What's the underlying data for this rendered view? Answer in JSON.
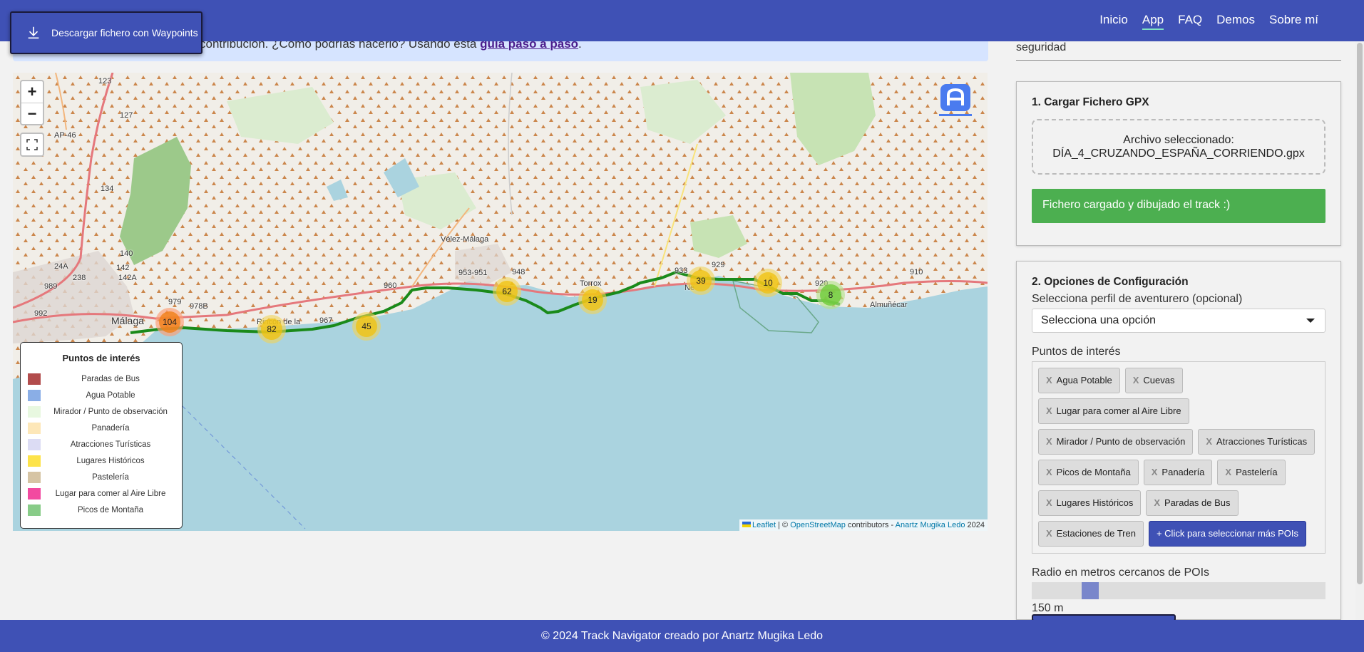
{
  "nav": {
    "links": [
      "Inicio",
      "App",
      "FAQ",
      "Demos",
      "Sobre mí"
    ],
    "active": "App"
  },
  "download_button": {
    "label": "Descargar fichero con Waypoints"
  },
  "banner": {
    "text": "contribución. ¿Cómo podrías hacerlo? Usando esta ",
    "link": "guía paso a paso",
    "end": "."
  },
  "map": {
    "zoom_in": "+",
    "zoom_out": "−",
    "places": {
      "malaga": "Málaga",
      "velez": "Vélez-Málaga",
      "torrox": "Torrox",
      "almunecar": "Almuñécar",
      "rincon": "Rincón de la",
      "nerja": "Ne"
    },
    "clusters": [
      "104",
      "82",
      "45",
      "62",
      "19",
      "39",
      "10",
      "8"
    ],
    "road_labels": {
      "ap46": "AP-46",
      "r123": "123",
      "r127": "127",
      "r134": "134",
      "r140": "140",
      "r142": "142",
      "r24a": "24A",
      "r238": "238",
      "r989": "989",
      "r142a": "142A",
      "r979": "979",
      "r9788": "978B",
      "r992": "992",
      "r960": "960",
      "r967": "967",
      "r953": "953-951",
      "r948": "948",
      "r933": "933",
      "r929": "929",
      "r920": "920",
      "r910": "910"
    },
    "attribution": {
      "leaflet": "Leaflet",
      "osm": "OpenStreetMap",
      "contributors": "contributors -",
      "author": "Anartz Mugika Ledo",
      "year": "2024",
      "sep": "| ©"
    }
  },
  "legend": {
    "title": "Puntos de interés",
    "items": [
      {
        "label": "Paradas de Bus",
        "color": "#b24c4c"
      },
      {
        "label": "Agua Potable",
        "color": "#8aaee6"
      },
      {
        "label": "Mirador / Punto de observación",
        "color": "#e8f8e0"
      },
      {
        "label": "Panadería",
        "color": "#fde7b8"
      },
      {
        "label": "Atracciones Turísticas",
        "color": "#dcdcf4"
      },
      {
        "label": "Lugares Históricos",
        "color": "#fde34a"
      },
      {
        "label": "Pastelería",
        "color": "#d6c4a4"
      },
      {
        "label": "Lugar para comer al Aire Libre",
        "color": "#f24aa0"
      },
      {
        "label": "Picos de Montaña",
        "color": "#88cc88"
      }
    ]
  },
  "right": {
    "top_text": "seguridad",
    "section1": {
      "title": "1. Cargar Fichero GPX",
      "file_label": "Archivo seleccionado:",
      "file_name": "DÍA_4_CRUZANDO_ESPAÑA_CORRIENDO.gpx",
      "status": "Fichero cargado y dibujado el track :)"
    },
    "section2": {
      "title": "2. Opciones de Configuración",
      "profile_label": "Selecciona perfil de aventurero (opcional)",
      "profile_value": "Selecciona una opción",
      "pois_label": "Puntos de interés",
      "chips": [
        "Agua Potable",
        "Cuevas",
        "Lugar para comer al Aire Libre",
        "Mirador / Punto de observación",
        "Atracciones Turísticas",
        "Picos de Montaña",
        "Panadería",
        "Pastelería",
        "Lugares Históricos",
        "Paradas de Bus",
        "Estaciones de Tren"
      ],
      "more_button": "+ Click para seleccionar más POIs",
      "chip_x": "X",
      "radius_label": "Radio en metros cercanos de POIs",
      "radius_value": "150 m",
      "radius_fraction": 0.18
    }
  },
  "footer": {
    "text": "© 2024 Track Navigator creado por Anartz Mugika Ledo"
  }
}
